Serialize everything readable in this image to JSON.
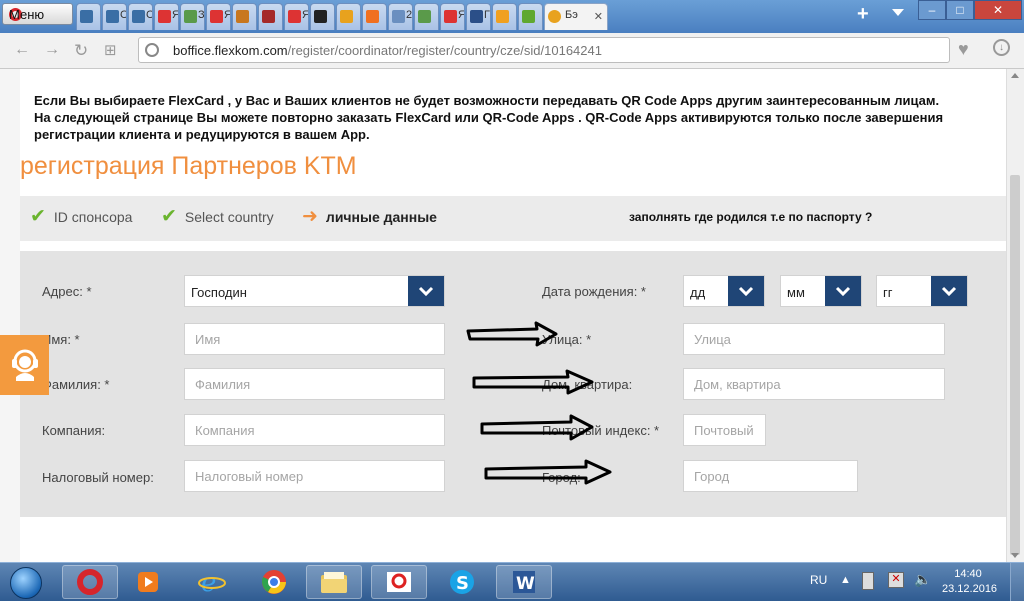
{
  "browser": {
    "menu_label": "Меню",
    "tabs": [
      {
        "icon": "user-icon",
        "label": "",
        "color": "#3a6ea5"
      },
      {
        "icon": "user-icon",
        "label": "С",
        "color": "#3a6ea5"
      },
      {
        "icon": "user-icon",
        "label": "С",
        "color": "#3a6ea5"
      },
      {
        "icon": "yandex-icon",
        "label": "Я",
        "color": "#d33"
      },
      {
        "icon": "image-icon",
        "label": "З",
        "color": "#5a9a4a"
      },
      {
        "icon": "yandex-icon",
        "label": "Я",
        "color": "#d33"
      },
      {
        "icon": "pattern-icon",
        "label": "",
        "color": "#c8771f"
      },
      {
        "icon": "grid-icon",
        "label": "",
        "color": "#a52a2a"
      },
      {
        "icon": "yandex-icon",
        "label": "Я",
        "color": "#d33"
      },
      {
        "icon": "m-icon",
        "label": "",
        "color": "#222"
      },
      {
        "icon": "orange-square-icon",
        "label": "",
        "color": "#e8a21e"
      },
      {
        "icon": "p-icon",
        "label": "",
        "color": "#f07020"
      },
      {
        "icon": "doc-icon",
        "label": "2",
        "color": "#6a8fc0"
      },
      {
        "icon": "image-icon",
        "label": "",
        "color": "#5a9a4a"
      },
      {
        "icon": "yandex-icon",
        "label": "Я",
        "color": "#d33"
      },
      {
        "icon": "cap-icon",
        "label": "Г",
        "color": "#2b4f88"
      },
      {
        "icon": "chevron-icon",
        "label": "",
        "color": "#f0a020"
      },
      {
        "icon": "upload-icon",
        "label": "",
        "color": "#5fa830"
      }
    ],
    "active_tab_label": "Бэ",
    "url_host": "boffice.flexkom.com",
    "url_path": "/register/coordinator/register/country/cze/sid/10164241"
  },
  "page": {
    "notice": "Если Вы выбираете FlexCard , у Вас и Ваших клиентов не будет возможности передавать QR Code Apps другим заинтересованным лицам. На следующей странице Вы можете повторно заказать FlexCard или QR-Code Apps . QR-Code Apps активируются только после завершения регистрации клиента и редуцируются в вашем App.",
    "title": "регистрация Партнеров KTM",
    "steps": [
      {
        "label": "ID спонсора",
        "state": "done"
      },
      {
        "label": "Select country",
        "state": "done"
      },
      {
        "label": "личные данные",
        "state": "current"
      }
    ],
    "hint": "заполнять где родился т.е по паспорту ?",
    "form": {
      "salutation_label": "Адрес: *",
      "salutation_value": "Господин",
      "first_name_label": "Имя: *",
      "first_name_placeholder": "Имя",
      "last_name_label": "Фамилия: *",
      "last_name_placeholder": "Фамилия",
      "company_label": "Компания:",
      "company_placeholder": "Компания",
      "tax_label": "Налоговый номер:",
      "tax_placeholder": "Налоговый номер",
      "birth_label": "Дата рождения: *",
      "birth_day": "дд",
      "birth_month": "мм",
      "birth_year": "гг",
      "street_label": "Улица: *",
      "street_placeholder": "Улица",
      "house_label": "Дом, квартира:",
      "house_placeholder": "Дом, квартира",
      "zip_label": "Почтовый индекс: *",
      "zip_placeholder": "Почтовый",
      "city_label": "Город:",
      "city_placeholder": "Город"
    },
    "colors": {
      "accent": "#f08f3f",
      "select_button": "#1f4576",
      "check": "#6ab42e"
    }
  },
  "taskbar": {
    "apps": [
      "opera-icon",
      "media-player-icon",
      "internet-explorer-icon",
      "chrome-icon",
      "file-explorer-icon",
      "flexkom-icon",
      "skype-icon",
      "word-icon"
    ],
    "language": "RU",
    "time": "14:40",
    "date": "23.12.2016"
  }
}
